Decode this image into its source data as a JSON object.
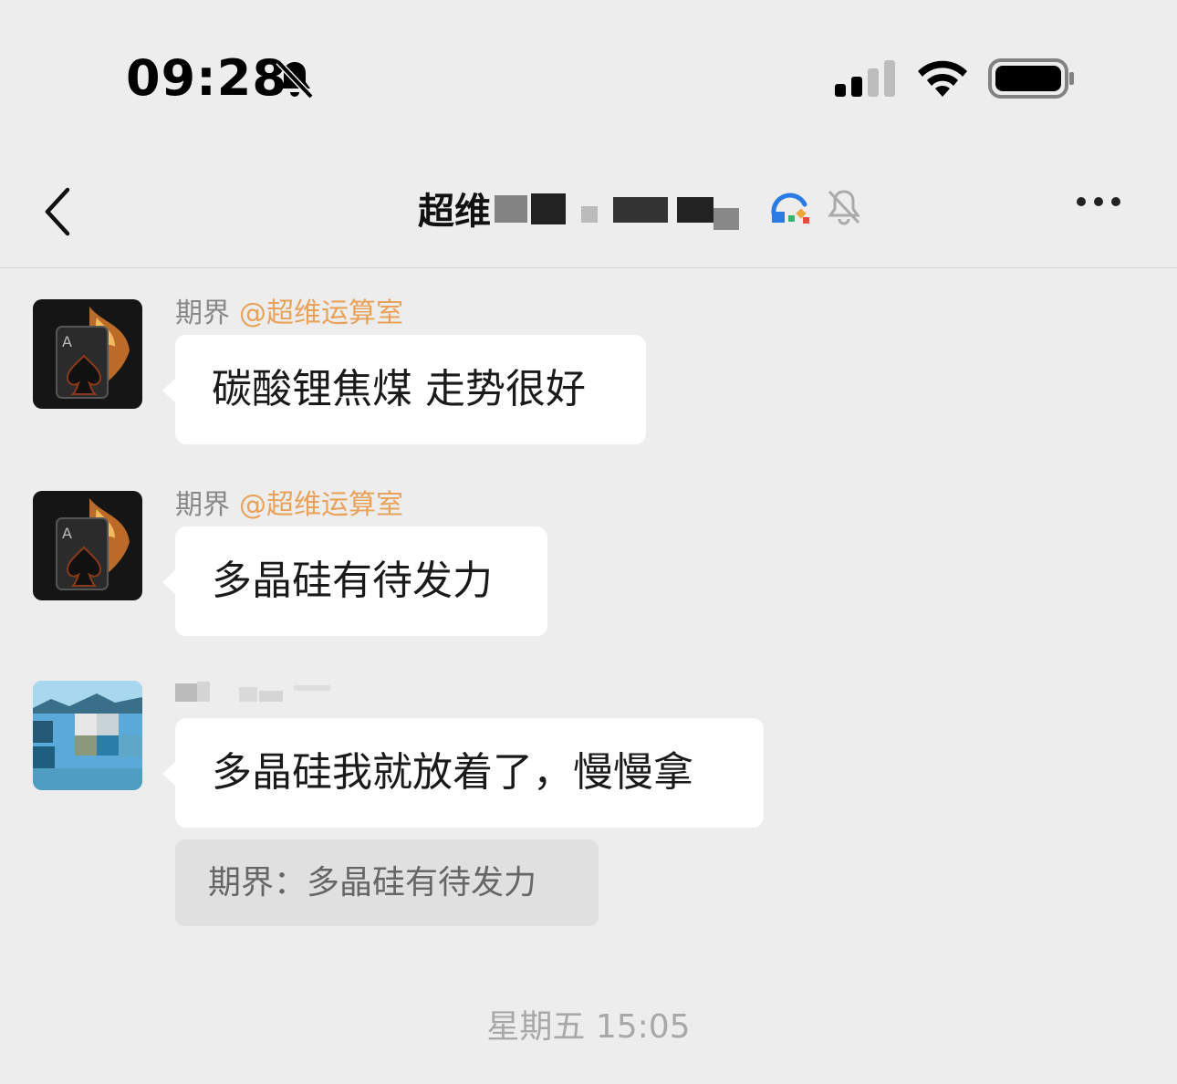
{
  "status_bar": {
    "time": "09:28",
    "icons": [
      "bell-off-icon",
      "cellular-signal-icon",
      "wifi-icon",
      "battery-icon"
    ]
  },
  "nav": {
    "back_icon": "chevron-left-icon",
    "title": "超维",
    "org_icon": "org-badge-icon",
    "mute_icon": "bell-off-icon",
    "more_icon": "more-dots-icon"
  },
  "messages": [
    {
      "sender": "期界",
      "mention": "@超维运算室",
      "text": "碳酸锂焦煤 走势很好"
    },
    {
      "sender": "期界",
      "mention": "@超维运算室",
      "text": "多晶硅有待发力"
    },
    {
      "sender": "",
      "text": "多晶硅我就放着了，慢慢拿",
      "quote": "期界：多晶硅有待发力"
    }
  ],
  "timestamp": "星期五 15:05",
  "colors": {
    "background": "#ededed",
    "bubble": "#ffffff",
    "mention": "#e8a25a",
    "quote_bg": "#e0e0e0"
  }
}
